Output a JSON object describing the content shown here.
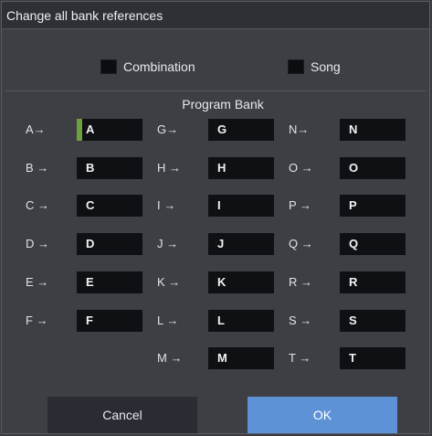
{
  "dialog": {
    "title": "Change all bank references",
    "options": [
      {
        "label": "Combination",
        "checked": false
      },
      {
        "label": "Song",
        "checked": false
      }
    ],
    "section_title": "Program Bank",
    "columns": [
      [
        {
          "from": "A→",
          "to": "A"
        },
        {
          "from": "B →",
          "to": "B"
        },
        {
          "from": "C →",
          "to": "C"
        },
        {
          "from": "D →",
          "to": "D"
        },
        {
          "from": "E →",
          "to": "E"
        },
        {
          "from": "F →",
          "to": "F"
        }
      ],
      [
        {
          "from": "G→",
          "to": "G"
        },
        {
          "from": "H →",
          "to": "H"
        },
        {
          "from": "I →",
          "to": "I"
        },
        {
          "from": "J →",
          "to": "J"
        },
        {
          "from": "K →",
          "to": "K"
        },
        {
          "from": "L →",
          "to": "L"
        },
        {
          "from": "M →",
          "to": "M"
        }
      ],
      [
        {
          "from": "N→",
          "to": "N"
        },
        {
          "from": "O →",
          "to": "O"
        },
        {
          "from": "P →",
          "to": "P"
        },
        {
          "from": "Q →",
          "to": "Q"
        },
        {
          "from": "R →",
          "to": "R"
        },
        {
          "from": "S →",
          "to": "S"
        },
        {
          "from": "T →",
          "to": "T"
        }
      ]
    ],
    "selected_slot": "A",
    "buttons": {
      "cancel": "Cancel",
      "ok": "OK"
    },
    "colors": {
      "accent": "#5d93d6",
      "selection": "#6fa03e"
    }
  }
}
